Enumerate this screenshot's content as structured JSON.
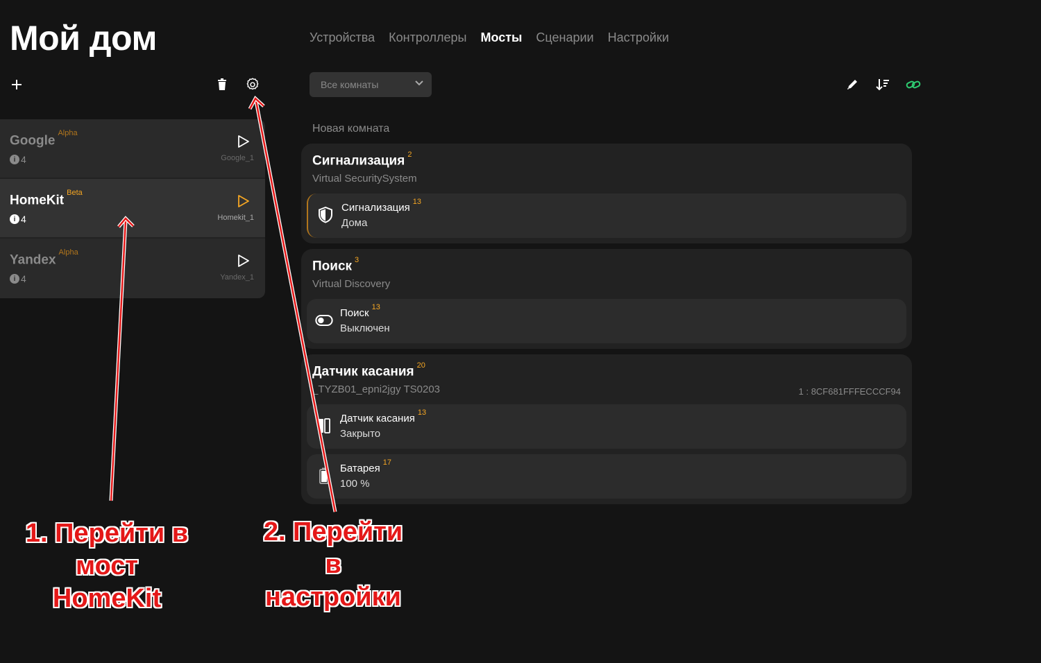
{
  "app": {
    "title": "Мой дом"
  },
  "nav": {
    "tabs": [
      "Устройства",
      "Контроллеры",
      "Мосты",
      "Сценарии",
      "Настройки"
    ],
    "active": "Мосты"
  },
  "toolbar": {
    "add_icon": "plus-icon",
    "delete_icon": "trash-icon",
    "settings_icon": "gear-icon"
  },
  "bridges": [
    {
      "name": "Google",
      "badge": "Alpha",
      "count": "4",
      "id": "Google_1",
      "active": false
    },
    {
      "name": "HomeKit",
      "badge": "Beta",
      "count": "4",
      "id": "Homekit_1",
      "active": true
    },
    {
      "name": "Yandex",
      "badge": "Alpha",
      "count": "4",
      "id": "Yandex_1",
      "active": false
    }
  ],
  "filter": {
    "rooms_value": "Все комнаты"
  },
  "actions": {
    "edit_icon": "pencil-icon",
    "sort_icon": "sort-icon",
    "link_icon": "link-icon"
  },
  "room": {
    "name": "Новая комната"
  },
  "devices": [
    {
      "title": "Сигнализация",
      "sup": "2",
      "subtitle": "Virtual SecuritySystem",
      "right": "",
      "items": [
        {
          "title": "Сигнализация",
          "sup": "13",
          "value": "Дома",
          "icon": "shield-icon"
        }
      ]
    },
    {
      "title": "Поиск",
      "sup": "3",
      "subtitle": "Virtual Discovery",
      "right": "",
      "items": [
        {
          "title": "Поиск",
          "sup": "13",
          "value": "Выключен",
          "icon": "toggle-icon"
        }
      ]
    },
    {
      "title": "Датчик касания",
      "sup": "20",
      "subtitle": "_TYZB01_epni2jgy TS0203",
      "right": "1 : 8CF681FFFECCCF94",
      "items": [
        {
          "title": "Датчик касания",
          "sup": "13",
          "value": "Закрыто",
          "icon": "contact-sensor-icon"
        },
        {
          "title": "Батарея",
          "sup": "17",
          "value": "100 %",
          "icon": "battery-icon"
        }
      ]
    }
  ],
  "annotations": {
    "note1": [
      "1. Перейти в",
      "мост",
      "HomeKit"
    ],
    "note2": [
      "2. Перейти",
      "в",
      "настройки"
    ]
  },
  "colors": {
    "background": "#141414",
    "accent": "#f5a623",
    "link_green": "#2ecc71",
    "annotation": "#e41818"
  }
}
